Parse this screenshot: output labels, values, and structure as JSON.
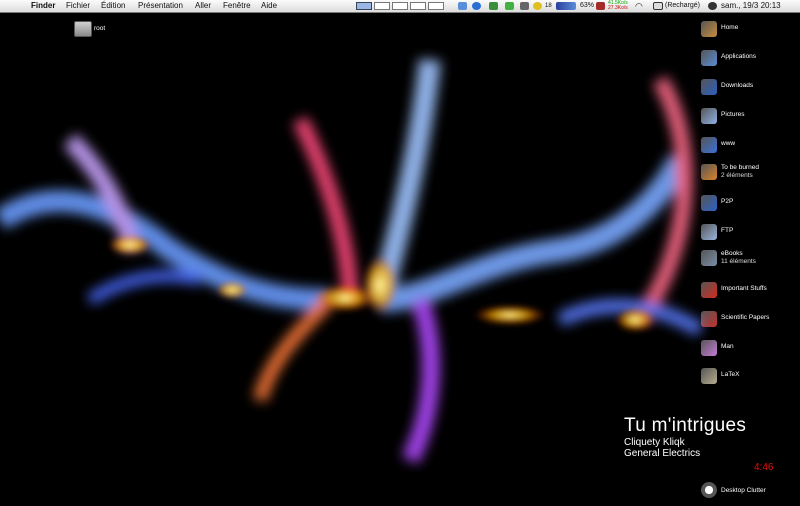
{
  "menubar": {
    "apple_glyph": "",
    "menus": [
      "Finder",
      "Fichier",
      "Édition",
      "Présentation",
      "Aller",
      "Fenêtre",
      "Aide"
    ],
    "battery_percent": "63%",
    "net_up": "41.5Ko/s",
    "net_down": "27.3Ko/s",
    "counter": "18",
    "power_status": "(Rechargé)",
    "clock": "sam., 19/3  20:13"
  },
  "desktop": {
    "root_label": "root",
    "items": [
      {
        "label": "Home",
        "icon": "home-icon",
        "color": "#c98d3c"
      },
      {
        "label": "Applications",
        "icon": "applications-folder-icon",
        "color": "#5a8ed6"
      },
      {
        "label": "Downloads",
        "icon": "downloads-folder-icon",
        "color": "#2a5fbf"
      },
      {
        "label": "Pictures",
        "icon": "pictures-folder-icon",
        "color": "#8fb2e8"
      },
      {
        "label": "www",
        "icon": "globe-icon",
        "color": "#3b6fd9"
      },
      {
        "label": "To be burned",
        "sub": "2 éléments",
        "icon": "burn-folder-icon",
        "color": "#d9822b"
      },
      {
        "label": "P2P",
        "icon": "p2p-icon",
        "color": "#2c62c6"
      },
      {
        "label": "FTP",
        "icon": "ftp-icon",
        "color": "#9ab4e0"
      },
      {
        "label": "eBooks",
        "sub": "11 éléments",
        "icon": "ebooks-icon",
        "color": "#7a8fa8"
      },
      {
        "label": "Important Stuffs",
        "icon": "important-icon",
        "color": "#d42a1e"
      },
      {
        "label": "Scientific Papers",
        "icon": "papers-icon",
        "color": "#c23030"
      },
      {
        "label": "Man",
        "icon": "man-icon",
        "color": "#c77dd8"
      },
      {
        "label": "LaTeX",
        "icon": "latex-icon",
        "color": "#b9ad8f"
      }
    ],
    "clutter_label": "Desktop Clutter"
  },
  "now_playing": {
    "title": "Tu m'intrigues",
    "artist": "Cliquety Kliqk",
    "album": "General Electrics",
    "time": "4:46"
  }
}
